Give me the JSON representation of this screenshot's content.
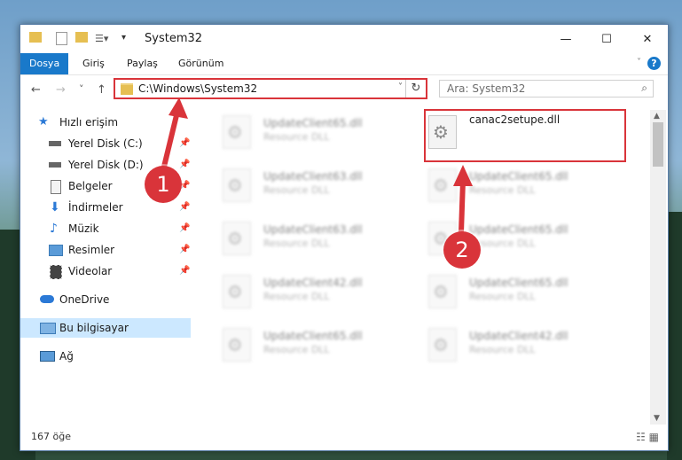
{
  "window": {
    "title": "System32",
    "controls": {
      "minimize": "—",
      "maximize": "☐",
      "close": "✕"
    }
  },
  "ribbon": {
    "tabs": [
      {
        "label": "Dosya",
        "active": true
      },
      {
        "label": "Giriş"
      },
      {
        "label": "Paylaş"
      },
      {
        "label": "Görünüm"
      }
    ],
    "help": "?"
  },
  "nav": {
    "back_icon": "←",
    "forward_icon": "→",
    "recent_icon": "˅",
    "up_icon": "↑",
    "address": "C:\\Windows\\System32",
    "dropdown_icon": "˅",
    "refresh_icon": "↻",
    "search_placeholder": "Ara: System32",
    "search_icon": "⌕"
  },
  "sidebar": {
    "items": [
      {
        "label": "Hızlı erişim",
        "icon": "star-icon"
      },
      {
        "label": "Yerel Disk (C:)",
        "icon": "drive-icon",
        "pinned": true
      },
      {
        "label": "Yerel Disk (D:)",
        "icon": "drive-icon",
        "pinned": true
      },
      {
        "label": "Belgeler",
        "icon": "documents-icon",
        "pinned": true
      },
      {
        "label": "İndirmeler",
        "icon": "download-icon",
        "pinned": true
      },
      {
        "label": "Müzik",
        "icon": "music-icon",
        "pinned": true
      },
      {
        "label": "Resimler",
        "icon": "pictures-icon",
        "pinned": true
      },
      {
        "label": "Videolar",
        "icon": "videos-icon",
        "pinned": true
      },
      {
        "label": "OneDrive",
        "icon": "cloud-icon"
      },
      {
        "label": "Bu bilgisayar",
        "icon": "computer-icon",
        "selected": true
      },
      {
        "label": "Ağ",
        "icon": "network-icon"
      }
    ],
    "pin_glyph": "📌"
  },
  "files": {
    "left": [
      {
        "name": "UpdateClient65.dll",
        "type": "Resource DLL"
      },
      {
        "name": "UpdateClient63.dll",
        "type": "Resource DLL"
      },
      {
        "name": "UpdateClient63.dll",
        "type": "Resource DLL"
      },
      {
        "name": "UpdateClient42.dll",
        "type": "Resource DLL"
      },
      {
        "name": "UpdateClient65.dll",
        "type": "Resource DLL"
      }
    ],
    "right": [
      {
        "name": "canac2setupe.dll",
        "type": ""
      },
      {
        "name": "UpdateClient65.dll",
        "type": "Resource DLL"
      },
      {
        "name": "UpdateClient65.dll",
        "type": "Resource DLL"
      },
      {
        "name": "UpdateClient65.dll",
        "type": "Resource DLL"
      },
      {
        "name": "UpdateClient42.dll",
        "type": "Resource DLL"
      }
    ]
  },
  "status": {
    "count": "167 öğe"
  },
  "annotations": {
    "marker1": "1",
    "marker2": "2",
    "color": "#d9343a"
  }
}
